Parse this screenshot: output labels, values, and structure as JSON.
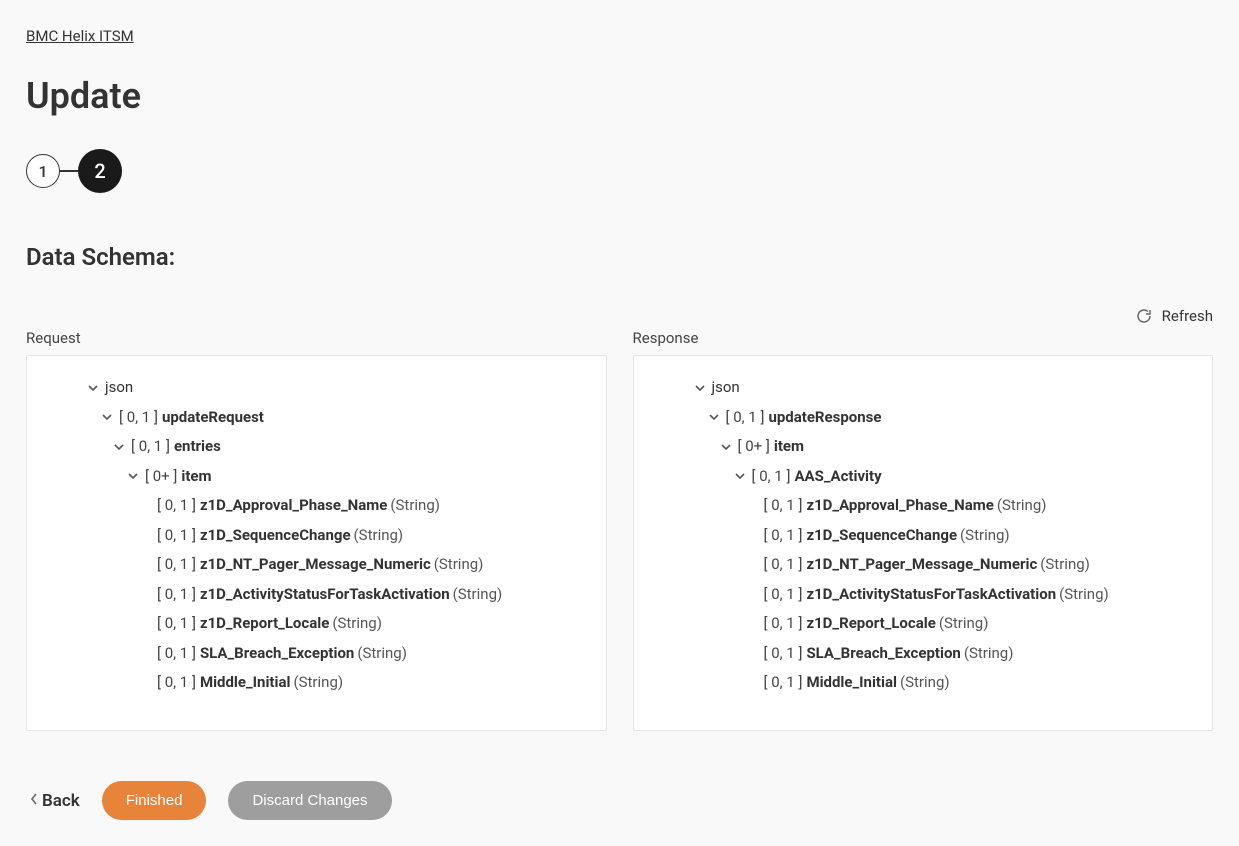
{
  "breadcrumb": "BMC Helix ITSM",
  "page_title": "Update",
  "stepper": {
    "step1": "1",
    "step2": "2"
  },
  "section_title": "Data Schema:",
  "refresh_label": "Refresh",
  "columns": {
    "request": "Request",
    "response": "Response"
  },
  "buttons": {
    "back": "Back",
    "finished": "Finished",
    "discard": "Discard Changes"
  },
  "tree_labels": {
    "json": "json",
    "string": "(String)"
  },
  "request_tree": {
    "root": "json",
    "l1": {
      "card": "[ 0, 1 ]",
      "name": "updateRequest"
    },
    "l2": {
      "card": "[ 0, 1 ]",
      "name": "entries"
    },
    "l3": {
      "card": "[ 0+ ]",
      "name": "item"
    },
    "leaves": [
      {
        "card": "[ 0, 1 ]",
        "name": "z1D_Approval_Phase_Name",
        "type": "(String)"
      },
      {
        "card": "[ 0, 1 ]",
        "name": "z1D_SequenceChange",
        "type": "(String)"
      },
      {
        "card": "[ 0, 1 ]",
        "name": "z1D_NT_Pager_Message_Numeric",
        "type": "(String)"
      },
      {
        "card": "[ 0, 1 ]",
        "name": "z1D_ActivityStatusForTaskActivation",
        "type": "(String)"
      },
      {
        "card": "[ 0, 1 ]",
        "name": "z1D_Report_Locale",
        "type": "(String)"
      },
      {
        "card": "[ 0, 1 ]",
        "name": "SLA_Breach_Exception",
        "type": "(String)"
      },
      {
        "card": "[ 0, 1 ]",
        "name": "Middle_Initial",
        "type": "(String)"
      }
    ]
  },
  "response_tree": {
    "root": "json",
    "l1": {
      "card": "[ 0, 1 ]",
      "name": "updateResponse"
    },
    "l2": {
      "card": "[ 0+ ]",
      "name": "item"
    },
    "l3": {
      "card": "[ 0, 1 ]",
      "name": "AAS_Activity"
    },
    "leaves": [
      {
        "card": "[ 0, 1 ]",
        "name": "z1D_Approval_Phase_Name",
        "type": "(String)"
      },
      {
        "card": "[ 0, 1 ]",
        "name": "z1D_SequenceChange",
        "type": "(String)"
      },
      {
        "card": "[ 0, 1 ]",
        "name": "z1D_NT_Pager_Message_Numeric",
        "type": "(String)"
      },
      {
        "card": "[ 0, 1 ]",
        "name": "z1D_ActivityStatusForTaskActivation",
        "type": "(String)"
      },
      {
        "card": "[ 0, 1 ]",
        "name": "z1D_Report_Locale",
        "type": "(String)"
      },
      {
        "card": "[ 0, 1 ]",
        "name": "SLA_Breach_Exception",
        "type": "(String)"
      },
      {
        "card": "[ 0, 1 ]",
        "name": "Middle_Initial",
        "type": "(String)"
      }
    ]
  }
}
